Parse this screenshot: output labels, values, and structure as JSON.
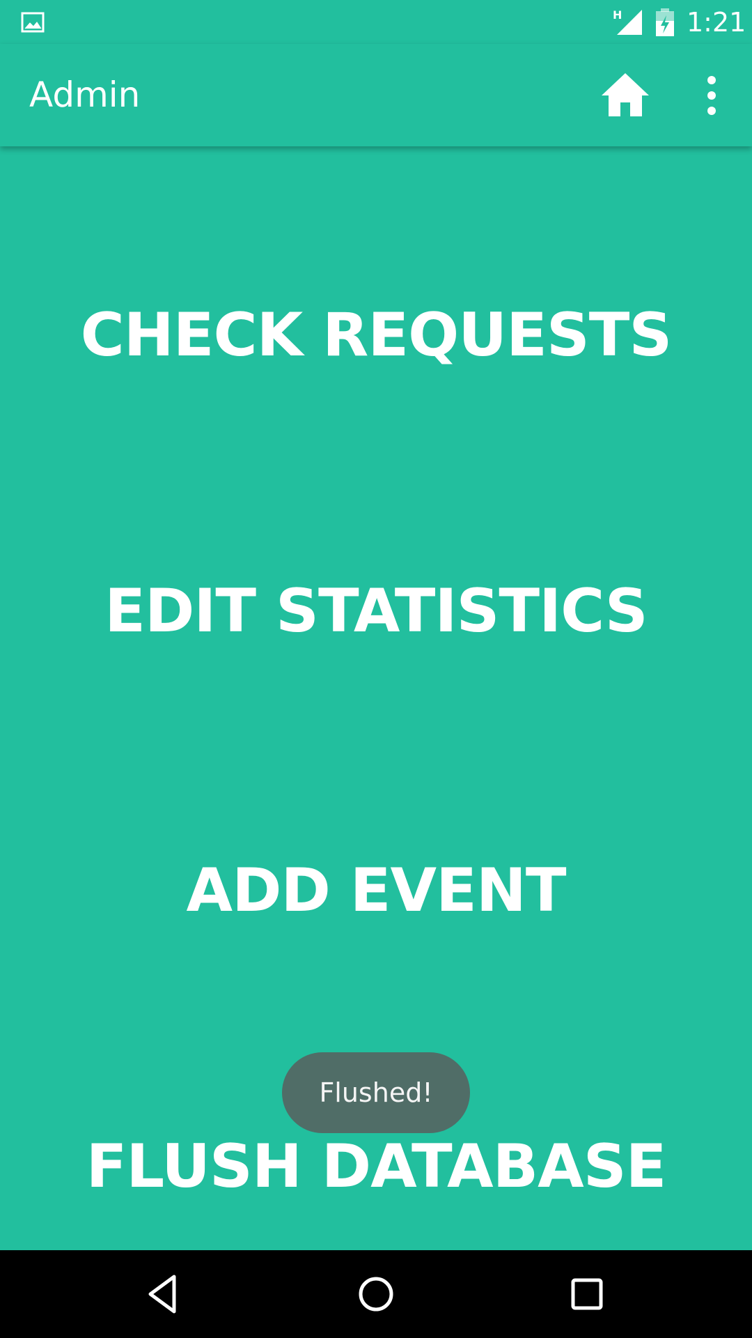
{
  "status_bar": {
    "network_type": "H",
    "time": "1:21",
    "icons": [
      "gallery-icon",
      "signal-icon",
      "battery-charging-icon"
    ]
  },
  "app_bar": {
    "title": "Admin",
    "icons": [
      "home-icon",
      "more-vert-icon"
    ]
  },
  "menu": {
    "items": [
      {
        "label": "CHECK REQUESTS"
      },
      {
        "label": "EDIT STATISTICS"
      },
      {
        "label": "ADD EVENT"
      },
      {
        "label": "FLUSH DATABASE"
      }
    ]
  },
  "toast": {
    "message": "Flushed!"
  },
  "nav_bar": {
    "icons": [
      "back-icon",
      "home-circle-icon",
      "recents-icon"
    ]
  },
  "colors": {
    "primary": "#22bf9e",
    "text": "#ffffff",
    "toast_bg": "#5a5a5a",
    "nav_bg": "#000000"
  }
}
